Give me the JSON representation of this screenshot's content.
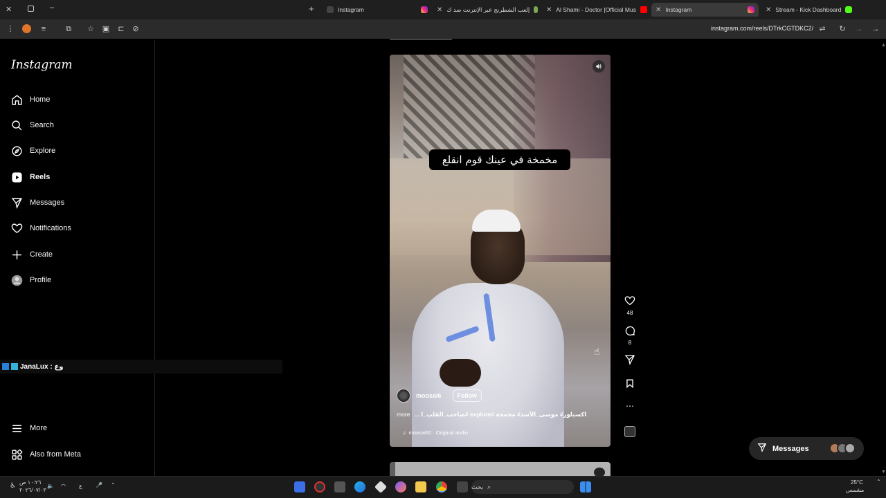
{
  "browser": {
    "tabs": [
      {
        "title": "Instagram",
        "favicon": "instagram-icon",
        "active": false
      },
      {
        "title": "إلعب الشطرنج عبر الإنترنت ضد ك",
        "favicon": "chess-icon",
        "active": false
      },
      {
        "title": "Al Shami - Doctor [Official Mus",
        "favicon": "youtube-icon",
        "active": false
      },
      {
        "title": "Instagram",
        "favicon": "instagram-icon",
        "active": true
      },
      {
        "title": "Stream - Kick Dashboard",
        "favicon": "kick-icon",
        "active": false
      }
    ],
    "url": "instagram.com/reels/DTrkCGTDKC2/"
  },
  "sidebar": {
    "logo": "Instagram",
    "items": [
      {
        "label": "Home",
        "icon": "home-icon"
      },
      {
        "label": "Search",
        "icon": "search-icon"
      },
      {
        "label": "Explore",
        "icon": "explore-icon"
      },
      {
        "label": "Reels",
        "icon": "reels-icon",
        "active": true
      },
      {
        "label": "Messages",
        "icon": "messages-icon"
      },
      {
        "label": "Notifications",
        "icon": "heart-icon"
      },
      {
        "label": "Create",
        "icon": "plus-icon"
      },
      {
        "label": "Profile",
        "icon": "profile-icon"
      }
    ],
    "more": "More",
    "also_from_meta": "Also from Meta"
  },
  "overlay": {
    "chat_line": "JanaLux : وع"
  },
  "reel": {
    "caption_overlay": "مخمخة في عينك قوم انقلع",
    "author": "moosai6",
    "follow_label": "Follow",
    "description_more": "more",
    "description": "... صاحب_القلب_ا# explore# اكسبلور# موسى_الأسد# مخمخة",
    "audio": "moosai60 · Original audio",
    "likes": "48",
    "comments": "8"
  },
  "messages_pill": {
    "label": "Messages"
  },
  "taskbar": {
    "time": "١٠:٢٦ ص",
    "date": "٢٠٢٦/٠٧/٠٣",
    "lang": "ع",
    "search_placeholder": "بحث",
    "temp": "25°C",
    "weather": "مشمس"
  },
  "colors": {
    "background": "#000000",
    "sidebar_border": "#262626",
    "pill_bg": "#262626",
    "tab_active": "#3a3a3a"
  }
}
